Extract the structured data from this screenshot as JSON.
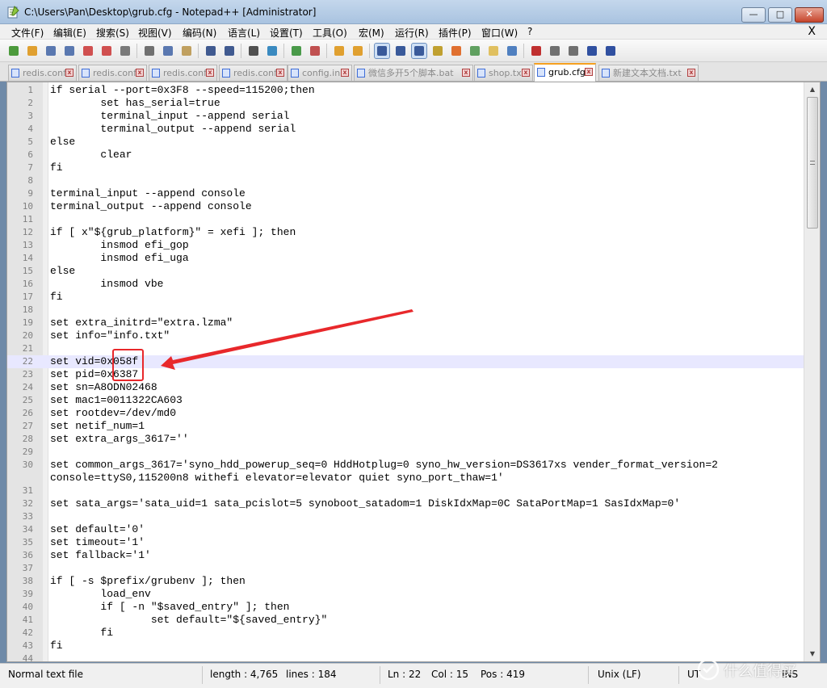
{
  "window": {
    "title": "C:\\Users\\Pan\\Desktop\\grub.cfg - Notepad++ [Administrator]",
    "minimize_label": "—",
    "maximize_label": "□",
    "close_label": "✕"
  },
  "menu": {
    "items": [
      "文件(F)",
      "编辑(E)",
      "搜索(S)",
      "视图(V)",
      "编码(N)",
      "语言(L)",
      "设置(T)",
      "工具(O)",
      "宏(M)",
      "运行(R)",
      "插件(P)",
      "窗口(W)",
      "?"
    ],
    "close_label": "X"
  },
  "toolbar": {
    "buttons": [
      "new-file",
      "open-file",
      "save",
      "save-all",
      "close",
      "close-all",
      "print",
      "cut",
      "copy",
      "paste",
      "undo",
      "redo",
      "find",
      "replace",
      "zoom-in",
      "zoom-out",
      "sync-vertical",
      "sync-horizontal",
      "word-wrap",
      "show-all-chars",
      "indent-guide",
      "user-language",
      "doc-map",
      "function-list",
      "folder-workspace",
      "monitor",
      "record-macro",
      "stop-record",
      "play-macro",
      "run-macro-multiple",
      "save-macro"
    ]
  },
  "tabs": [
    {
      "label": "redis.conf",
      "active": false
    },
    {
      "label": "redis.conf",
      "active": false
    },
    {
      "label": "redis.conf",
      "active": false
    },
    {
      "label": "redis.conf",
      "active": false
    },
    {
      "label": "config.ini",
      "active": false
    },
    {
      "label": "微信多开5个脚本.bat",
      "active": false
    },
    {
      "label": "shop.txt",
      "active": false
    },
    {
      "label": "grub.cfg",
      "active": true
    },
    {
      "label": "新建文本文档.txt",
      "active": false
    }
  ],
  "editor": {
    "current_line": 22,
    "lines": [
      {
        "n": "1",
        "text": "if serial --port=0x3F8 --speed=115200;then"
      },
      {
        "n": "2",
        "text": "        set has_serial=true"
      },
      {
        "n": "3",
        "text": "        terminal_input --append serial"
      },
      {
        "n": "4",
        "text": "        terminal_output --append serial"
      },
      {
        "n": "5",
        "text": "else"
      },
      {
        "n": "6",
        "text": "        clear"
      },
      {
        "n": "7",
        "text": "fi"
      },
      {
        "n": "8",
        "text": ""
      },
      {
        "n": "9",
        "text": "terminal_input --append console"
      },
      {
        "n": "10",
        "text": "terminal_output --append console"
      },
      {
        "n": "11",
        "text": ""
      },
      {
        "n": "12",
        "text": "if [ x\"${grub_platform}\" = xefi ]; then"
      },
      {
        "n": "13",
        "text": "        insmod efi_gop"
      },
      {
        "n": "14",
        "text": "        insmod efi_uga"
      },
      {
        "n": "15",
        "text": "else"
      },
      {
        "n": "16",
        "text": "        insmod vbe"
      },
      {
        "n": "17",
        "text": "fi"
      },
      {
        "n": "18",
        "text": ""
      },
      {
        "n": "19",
        "text": "set extra_initrd=\"extra.lzma\""
      },
      {
        "n": "20",
        "text": "set info=\"info.txt\""
      },
      {
        "n": "21",
        "text": ""
      },
      {
        "n": "22",
        "text": "set vid=0x058f"
      },
      {
        "n": "23",
        "text": "set pid=0x6387"
      },
      {
        "n": "24",
        "text": "set sn=A8ODN02468"
      },
      {
        "n": "25",
        "text": "set mac1=0011322CA603"
      },
      {
        "n": "26",
        "text": "set rootdev=/dev/md0"
      },
      {
        "n": "27",
        "text": "set netif_num=1"
      },
      {
        "n": "28",
        "text": "set extra_args_3617=''"
      },
      {
        "n": "29",
        "text": ""
      },
      {
        "n": "30",
        "text": "set common_args_3617='syno_hdd_powerup_seq=0 HddHotplug=0 syno_hw_version=DS3617xs vender_format_version=2"
      },
      {
        "n": "",
        "text": "console=ttyS0,115200n8 withefi elevator=elevator quiet syno_port_thaw=1'"
      },
      {
        "n": "31",
        "text": ""
      },
      {
        "n": "32",
        "text": "set sata_args='sata_uid=1 sata_pcislot=5 synoboot_satadom=1 DiskIdxMap=0C SataPortMap=1 SasIdxMap=0'"
      },
      {
        "n": "33",
        "text": ""
      },
      {
        "n": "34",
        "text": "set default='0'"
      },
      {
        "n": "35",
        "text": "set timeout='1'"
      },
      {
        "n": "36",
        "text": "set fallback='1'"
      },
      {
        "n": "37",
        "text": ""
      },
      {
        "n": "38",
        "text": "if [ -s $prefix/grubenv ]; then"
      },
      {
        "n": "39",
        "text": "        load_env"
      },
      {
        "n": "40",
        "text": "        if [ -n \"$saved_entry\" ]; then"
      },
      {
        "n": "41",
        "text": "                set default=\"${saved_entry}\""
      },
      {
        "n": "42",
        "text": "        fi"
      },
      {
        "n": "43",
        "text": "fi"
      },
      {
        "n": "44",
        "text": ""
      }
    ]
  },
  "status": {
    "file_type": "Normal text file",
    "length": "length : 4,765",
    "lines": "lines : 184",
    "ln": "Ln : 22",
    "col": "Col : 15",
    "pos": "Pos : 419",
    "eol": "Unix (LF)",
    "encoding": "UT",
    "mode": "INS"
  },
  "watermark": {
    "text": "什么值得买"
  },
  "colors": {
    "annotation": "#e8282b",
    "current_line": "#e8e8ff",
    "active_tab_accent": "#f5a020"
  }
}
